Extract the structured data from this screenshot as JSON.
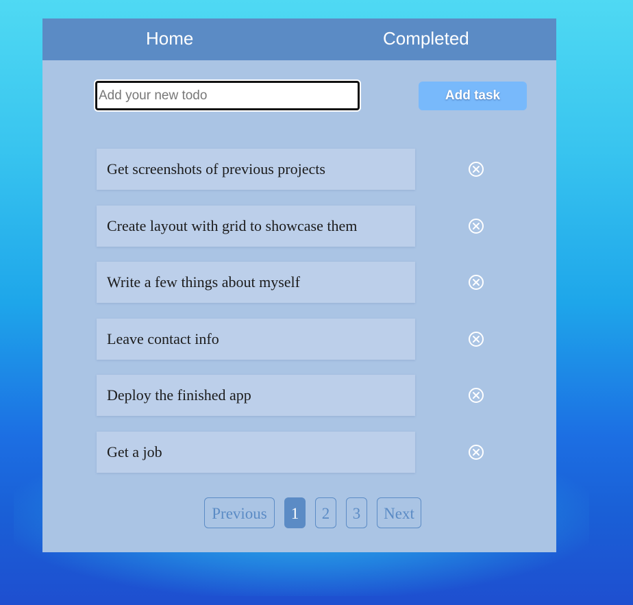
{
  "nav": {
    "home": "Home",
    "completed": "Completed"
  },
  "input": {
    "placeholder": "Add your new todo",
    "value": ""
  },
  "add_button": "Add task",
  "tasks": [
    {
      "text": "Get screenshots of previous projects",
      "icon": "circle-x-icon"
    },
    {
      "text": "Create layout with grid to showcase them",
      "icon": "circle-x-icon"
    },
    {
      "text": "Write a few things about myself",
      "icon": "circle-x-icon"
    },
    {
      "text": "Leave contact info",
      "icon": "circle-x-icon"
    },
    {
      "text": "Deploy the finished app",
      "icon": "circle-x-icon"
    },
    {
      "text": "Get a job",
      "icon": "circle-x-icon"
    }
  ],
  "pagination": {
    "previous": "Previous",
    "pages": [
      "1",
      "2",
      "3"
    ],
    "current": "1",
    "next": "Next"
  },
  "colors": {
    "nav_bg": "#5b8bc5",
    "card_bg": "#aac4e4",
    "task_bg": "#bccfea",
    "button_bg": "#78b9fb",
    "accent": "#5b8bc5"
  }
}
